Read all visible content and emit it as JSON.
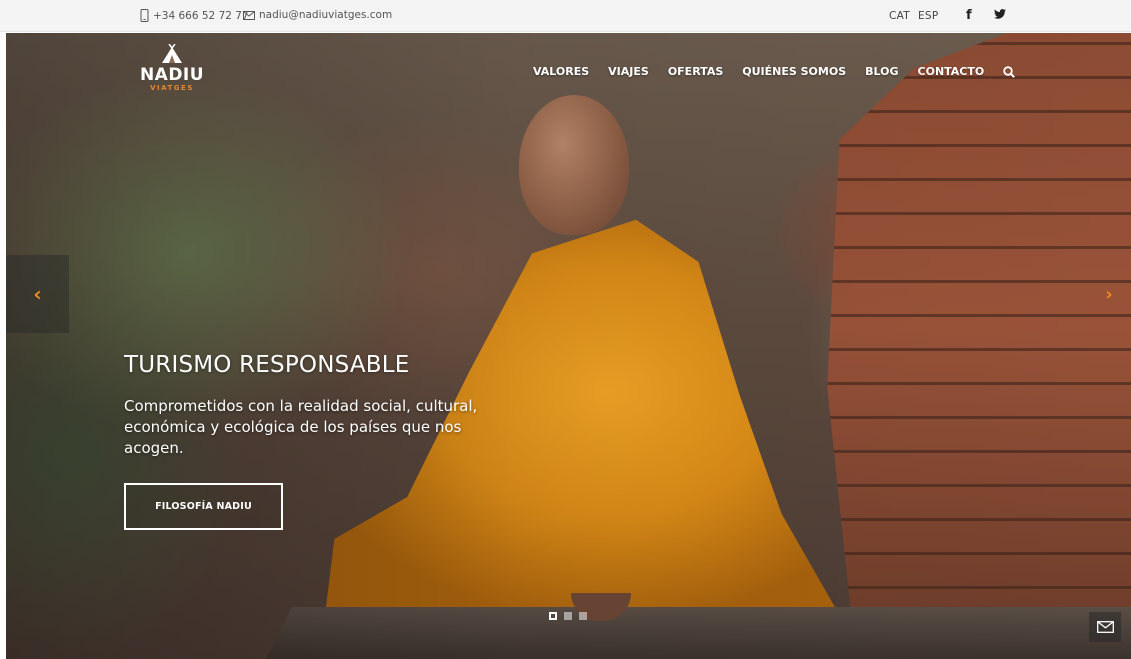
{
  "topbar": {
    "phone": "+34 666 52 72 77",
    "email": "nadiu@nadiuviatges.com",
    "languages": [
      "CAT",
      "ESP"
    ],
    "social": {
      "facebook": "f",
      "twitter": "twitter-icon"
    }
  },
  "logo": {
    "name": "NADIU",
    "sub": "VIATGES"
  },
  "nav": {
    "items": [
      "VALORES",
      "VIAJES",
      "OFERTAS",
      "QUIÉNES SOMOS",
      "BLOG",
      "CONTACTO"
    ],
    "search_icon": "search-icon"
  },
  "slider": {
    "prev_label": "‹",
    "next_label": "›",
    "title": "TURISMO RESPONSABLE",
    "text": "Comprometidos con la realidad social, cultural, económica y ecológica de los países que nos acogen.",
    "cta_label": "FILOSOFÍA NADIU",
    "slide_count": 3,
    "active_slide": 1
  },
  "float_contact_icon": "mail-icon",
  "colors": {
    "accent": "#f08a1c",
    "topbar_bg": "#f4f4f4",
    "robe": "#e3971f"
  }
}
